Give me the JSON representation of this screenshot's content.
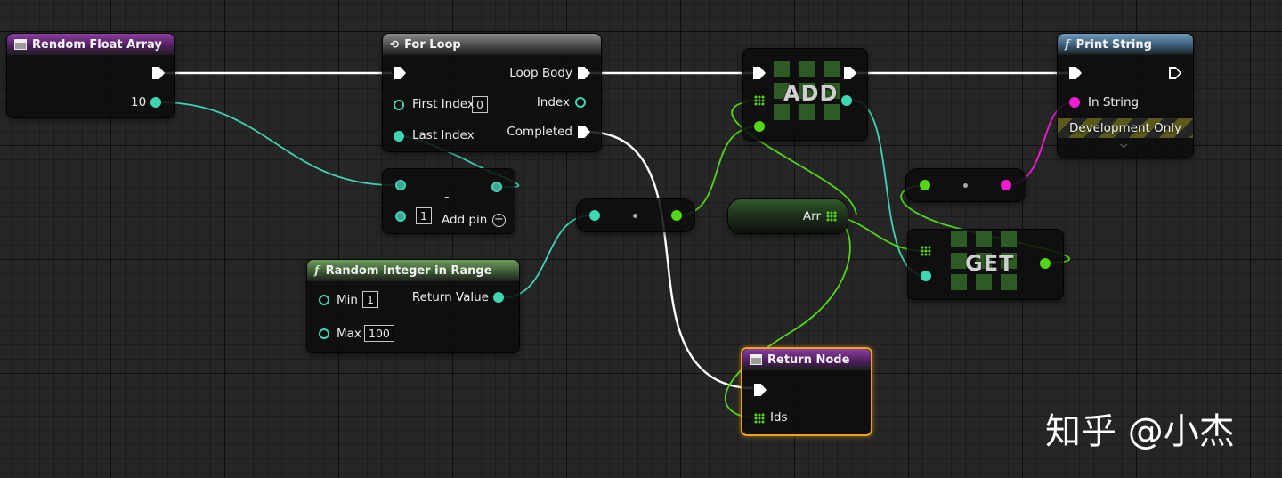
{
  "nodes": {
    "random_float_array": {
      "title": "Rendom Float Array",
      "output_value": "10"
    },
    "for_loop": {
      "title": "For Loop",
      "first_index_label": "First Index",
      "first_index_value": "0",
      "last_index_label": "Last Index",
      "loop_body_label": "Loop Body",
      "index_label": "Index",
      "completed_label": "Completed"
    },
    "subtract": {
      "op": "-",
      "input_value": "1",
      "add_pin_label": "Add pin"
    },
    "random_integer": {
      "title": "Random Integer in Range",
      "min_label": "Min",
      "min_value": "1",
      "max_label": "Max",
      "max_value": "100",
      "return_label": "Return Value"
    },
    "add": {
      "op": "ADD"
    },
    "arr_var": {
      "label": "Arr"
    },
    "get": {
      "op": "GET"
    },
    "print_string": {
      "title": "Print String",
      "in_string_label": "In String",
      "dev_only_label": "Development Only"
    },
    "return_node": {
      "title": "Return Node",
      "ids_label": "Ids"
    }
  },
  "colors": {
    "exec": "#ffffff",
    "integer": "#3fd4b2",
    "float": "#52d615",
    "string": "#f21cd3",
    "selected_outline": "#f0a020"
  },
  "watermark": "知乎 @小杰"
}
